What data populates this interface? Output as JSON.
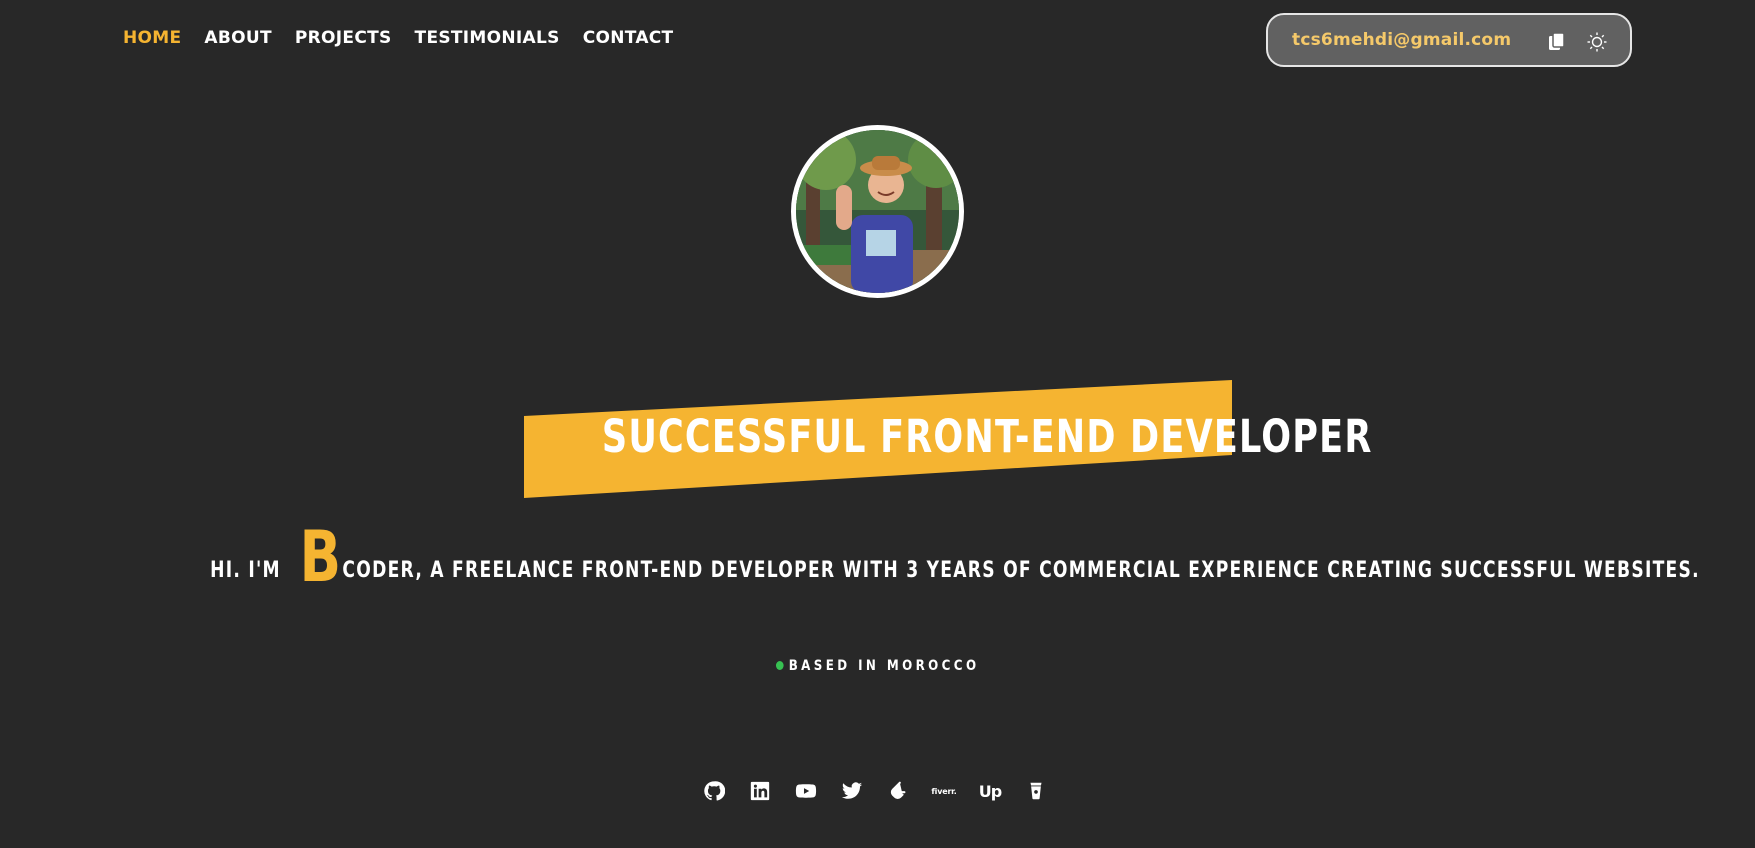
{
  "nav": {
    "items": [
      {
        "label": "HOME",
        "active": true
      },
      {
        "label": "ABOUT",
        "active": false
      },
      {
        "label": "PROJECTS",
        "active": false
      },
      {
        "label": "TESTIMONIALS",
        "active": false
      },
      {
        "label": "CONTACT",
        "active": false
      }
    ],
    "email": "tcs6mehdi@gmail.com",
    "copy_icon": "copy-icon",
    "theme_icon": "sun-icon"
  },
  "hero": {
    "avatar_alt": "avatar",
    "headline": "SUCCESSFUL FRONT-END DEVELOPER",
    "intro_prefix": "HI. I'M",
    "intro_letter": "B",
    "intro_rest": "CODER, A FREELANCE FRONT-END DEVELOPER WITH 3 YEARS OF COMMERCIAL EXPERIENCE CREATING SUCCESSFUL WEBSITES.",
    "location": "BASED IN MOROCCO"
  },
  "socials": {
    "icons": [
      "github-icon",
      "linkedin-icon",
      "youtube-icon",
      "twitter-icon",
      "leetcode-icon",
      "fiverr-icon",
      "upwork-icon",
      "coffee-icon"
    ],
    "fiverr_text": "fiverr.",
    "upwork_text": "Up"
  },
  "colors": {
    "background": "#282828",
    "accent": "#f5b431",
    "status_dot": "#37c152"
  }
}
